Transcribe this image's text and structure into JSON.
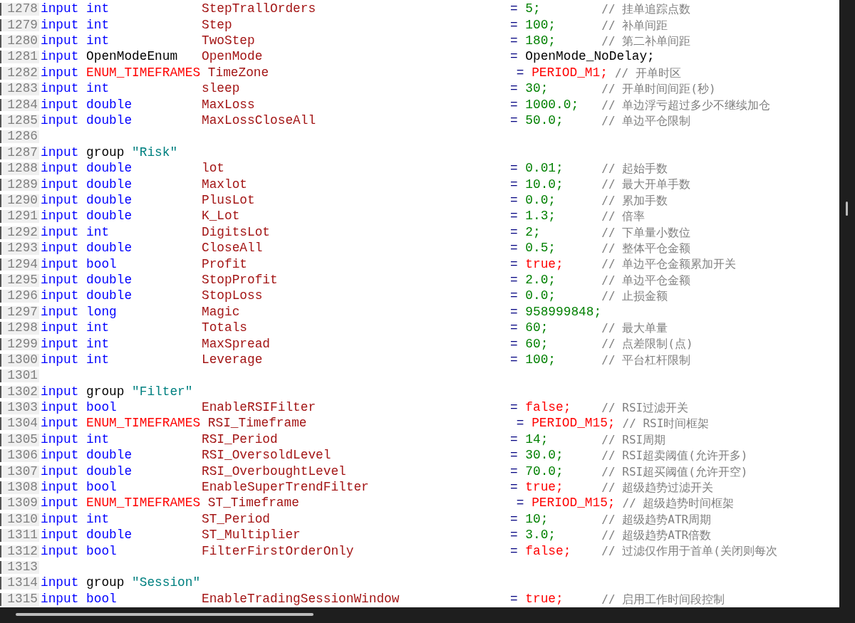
{
  "lines": [
    {
      "number": "1278",
      "kind": "param",
      "keyword": "input",
      "type": {
        "text": "int",
        "kind": "builtin"
      },
      "name": "StepTrallOrders",
      "op": "=",
      "value": {
        "text": "5;",
        "kind": "number"
      },
      "comment": "// 挂单追踪点数"
    },
    {
      "number": "1279",
      "kind": "param",
      "keyword": "input",
      "type": {
        "text": "int",
        "kind": "builtin"
      },
      "name": "Step",
      "op": "=",
      "value": {
        "text": "100;",
        "kind": "number"
      },
      "comment": "// 补单间距"
    },
    {
      "number": "1280",
      "kind": "param",
      "keyword": "input",
      "type": {
        "text": "int",
        "kind": "builtin"
      },
      "name": "TwoStep",
      "op": "=",
      "value": {
        "text": "180;",
        "kind": "number"
      },
      "comment": "// 第二补单间距"
    },
    {
      "number": "1281",
      "kind": "param",
      "keyword": "input",
      "type": {
        "text": "OpenModeEnum",
        "kind": "user"
      },
      "name": "OpenMode",
      "op": "=",
      "value": {
        "text": "OpenMode_NoDelay;",
        "kind": "identifier"
      }
    },
    {
      "number": "1282",
      "kind": "param",
      "keyword": "input",
      "type": {
        "text": "ENUM_TIMEFRAMES",
        "kind": "enum"
      },
      "name": "TimeZone",
      "op": "=",
      "value": {
        "text": "PERIOD_M1;",
        "kind": "constant"
      },
      "comment": "// 开单时区"
    },
    {
      "number": "1283",
      "kind": "param",
      "keyword": "input",
      "type": {
        "text": "int",
        "kind": "builtin"
      },
      "name": "sleep",
      "op": "=",
      "value": {
        "text": "30;",
        "kind": "number"
      },
      "comment": "// 开单时间间距(秒)"
    },
    {
      "number": "1284",
      "kind": "param",
      "keyword": "input",
      "type": {
        "text": "double",
        "kind": "builtin"
      },
      "name": "MaxLoss",
      "op": "=",
      "value": {
        "text": "1000.0;",
        "kind": "number"
      },
      "comment": "// 单边浮亏超过多少不继续加仓"
    },
    {
      "number": "1285",
      "kind": "param",
      "keyword": "input",
      "type": {
        "text": "double",
        "kind": "builtin"
      },
      "name": "MaxLossCloseAll",
      "op": "=",
      "value": {
        "text": "50.0;",
        "kind": "number"
      },
      "comment": "// 单边平仓限制"
    },
    {
      "number": "1286",
      "kind": "blank"
    },
    {
      "number": "1287",
      "kind": "group",
      "keyword": "input",
      "type": {
        "text": "group",
        "kind": "user"
      },
      "label": "\"Risk\""
    },
    {
      "number": "1288",
      "kind": "param",
      "keyword": "input",
      "type": {
        "text": "double",
        "kind": "builtin"
      },
      "name": "lot",
      "op": "=",
      "value": {
        "text": "0.01;",
        "kind": "number"
      },
      "comment": "// 起始手数"
    },
    {
      "number": "1289",
      "kind": "param",
      "keyword": "input",
      "type": {
        "text": "double",
        "kind": "builtin"
      },
      "name": "Maxlot",
      "op": "=",
      "value": {
        "text": "10.0;",
        "kind": "number"
      },
      "comment": "// 最大开单手数"
    },
    {
      "number": "1290",
      "kind": "param",
      "keyword": "input",
      "type": {
        "text": "double",
        "kind": "builtin"
      },
      "name": "PlusLot",
      "op": "=",
      "value": {
        "text": "0.0;",
        "kind": "number"
      },
      "comment": "// 累加手数"
    },
    {
      "number": "1291",
      "kind": "param",
      "keyword": "input",
      "type": {
        "text": "double",
        "kind": "builtin"
      },
      "name": "K_Lot",
      "op": "=",
      "value": {
        "text": "1.3;",
        "kind": "number"
      },
      "comment": "// 倍率"
    },
    {
      "number": "1292",
      "kind": "param",
      "keyword": "input",
      "type": {
        "text": "int",
        "kind": "builtin"
      },
      "name": "DigitsLot",
      "op": "=",
      "value": {
        "text": "2;",
        "kind": "number"
      },
      "comment": "// 下单量小数位"
    },
    {
      "number": "1293",
      "kind": "param",
      "keyword": "input",
      "type": {
        "text": "double",
        "kind": "builtin"
      },
      "name": "CloseAll",
      "op": "=",
      "value": {
        "text": "0.5;",
        "kind": "number"
      },
      "comment": "// 整体平仓金额"
    },
    {
      "number": "1294",
      "kind": "param",
      "keyword": "input",
      "type": {
        "text": "bool",
        "kind": "builtin"
      },
      "name": "Profit",
      "op": "=",
      "value": {
        "text": "true;",
        "kind": "constant"
      },
      "comment": "// 单边平仓金额累加开关"
    },
    {
      "number": "1295",
      "kind": "param",
      "keyword": "input",
      "type": {
        "text": "double",
        "kind": "builtin"
      },
      "name": "StopProfit",
      "op": "=",
      "value": {
        "text": "2.0;",
        "kind": "number"
      },
      "comment": "// 单边平仓金额"
    },
    {
      "number": "1296",
      "kind": "param",
      "keyword": "input",
      "type": {
        "text": "double",
        "kind": "builtin"
      },
      "name": "StopLoss",
      "op": "=",
      "value": {
        "text": "0.0;",
        "kind": "number"
      },
      "comment": "// 止损金额"
    },
    {
      "number": "1297",
      "kind": "param",
      "keyword": "input",
      "type": {
        "text": "long",
        "kind": "builtin"
      },
      "name": "Magic",
      "op": "=",
      "value": {
        "text": "958999848;",
        "kind": "number"
      }
    },
    {
      "number": "1298",
      "kind": "param",
      "keyword": "input",
      "type": {
        "text": "int",
        "kind": "builtin"
      },
      "name": "Totals",
      "op": "=",
      "value": {
        "text": "60;",
        "kind": "number"
      },
      "comment": "// 最大单量"
    },
    {
      "number": "1299",
      "kind": "param",
      "keyword": "input",
      "type": {
        "text": "int",
        "kind": "builtin"
      },
      "name": "MaxSpread",
      "op": "=",
      "value": {
        "text": "60;",
        "kind": "number"
      },
      "comment": "// 点差限制(点)"
    },
    {
      "number": "1300",
      "kind": "param",
      "keyword": "input",
      "type": {
        "text": "int",
        "kind": "builtin"
      },
      "name": "Leverage",
      "op": "=",
      "value": {
        "text": "100;",
        "kind": "number"
      },
      "comment": "// 平台杠杆限制"
    },
    {
      "number": "1301",
      "kind": "blank"
    },
    {
      "number": "1302",
      "kind": "group",
      "keyword": "input",
      "type": {
        "text": "group",
        "kind": "user"
      },
      "label": "\"Filter\""
    },
    {
      "number": "1303",
      "kind": "param",
      "keyword": "input",
      "type": {
        "text": "bool",
        "kind": "builtin"
      },
      "name": "EnableRSIFilter",
      "op": "=",
      "value": {
        "text": "false;",
        "kind": "constant"
      },
      "comment": "// RSI过滤开关"
    },
    {
      "number": "1304",
      "kind": "param",
      "keyword": "input",
      "type": {
        "text": "ENUM_TIMEFRAMES",
        "kind": "enum"
      },
      "name": "RSI_Timeframe",
      "op": "=",
      "value": {
        "text": "PERIOD_M15;",
        "kind": "constant"
      },
      "comment": "// RSI时间框架"
    },
    {
      "number": "1305",
      "kind": "param",
      "keyword": "input",
      "type": {
        "text": "int",
        "kind": "builtin"
      },
      "name": "RSI_Period",
      "op": "=",
      "value": {
        "text": "14;",
        "kind": "number"
      },
      "comment": "// RSI周期"
    },
    {
      "number": "1306",
      "kind": "param",
      "keyword": "input",
      "type": {
        "text": "double",
        "kind": "builtin"
      },
      "name": "RSI_OversoldLevel",
      "op": "=",
      "value": {
        "text": "30.0;",
        "kind": "number"
      },
      "comment": "// RSI超卖阈值(允许开多)"
    },
    {
      "number": "1307",
      "kind": "param",
      "keyword": "input",
      "type": {
        "text": "double",
        "kind": "builtin"
      },
      "name": "RSI_OverboughtLevel",
      "op": "=",
      "value": {
        "text": "70.0;",
        "kind": "number"
      },
      "comment": "// RSI超买阈值(允许开空)"
    },
    {
      "number": "1308",
      "kind": "param",
      "keyword": "input",
      "type": {
        "text": "bool",
        "kind": "builtin"
      },
      "name": "EnableSuperTrendFilter",
      "op": "=",
      "value": {
        "text": "true;",
        "kind": "constant"
      },
      "comment": "// 超级趋势过滤开关"
    },
    {
      "number": "1309",
      "kind": "param",
      "keyword": "input",
      "type": {
        "text": "ENUM_TIMEFRAMES",
        "kind": "enum"
      },
      "name": "ST_Timeframe",
      "op": "=",
      "value": {
        "text": "PERIOD_M15;",
        "kind": "constant"
      },
      "comment": "// 超级趋势时间框架"
    },
    {
      "number": "1310",
      "kind": "param",
      "keyword": "input",
      "type": {
        "text": "int",
        "kind": "builtin"
      },
      "name": "ST_Period",
      "op": "=",
      "value": {
        "text": "10;",
        "kind": "number"
      },
      "comment": "// 超级趋势ATR周期"
    },
    {
      "number": "1311",
      "kind": "param",
      "keyword": "input",
      "type": {
        "text": "double",
        "kind": "builtin"
      },
      "name": "ST_Multiplier",
      "op": "=",
      "value": {
        "text": "3.0;",
        "kind": "number"
      },
      "comment": "// 超级趋势ATR倍数"
    },
    {
      "number": "1312",
      "kind": "param",
      "keyword": "input",
      "type": {
        "text": "bool",
        "kind": "builtin"
      },
      "name": "FilterFirstOrderOnly",
      "op": "=",
      "value": {
        "text": "false;",
        "kind": "constant"
      },
      "comment": "// 过滤仅作用于首单(关闭则每次"
    },
    {
      "number": "1313",
      "kind": "blank"
    },
    {
      "number": "1314",
      "kind": "group",
      "keyword": "input",
      "type": {
        "text": "group",
        "kind": "user"
      },
      "label": "\"Session\""
    },
    {
      "number": "1315",
      "kind": "param",
      "keyword": "input",
      "type": {
        "text": "bool",
        "kind": "builtin"
      },
      "name": "EnableTradingSessionWindow",
      "op": "=",
      "value": {
        "text": "true;",
        "kind": "constant"
      },
      "comment": "// 启用工作时间段控制"
    }
  ]
}
